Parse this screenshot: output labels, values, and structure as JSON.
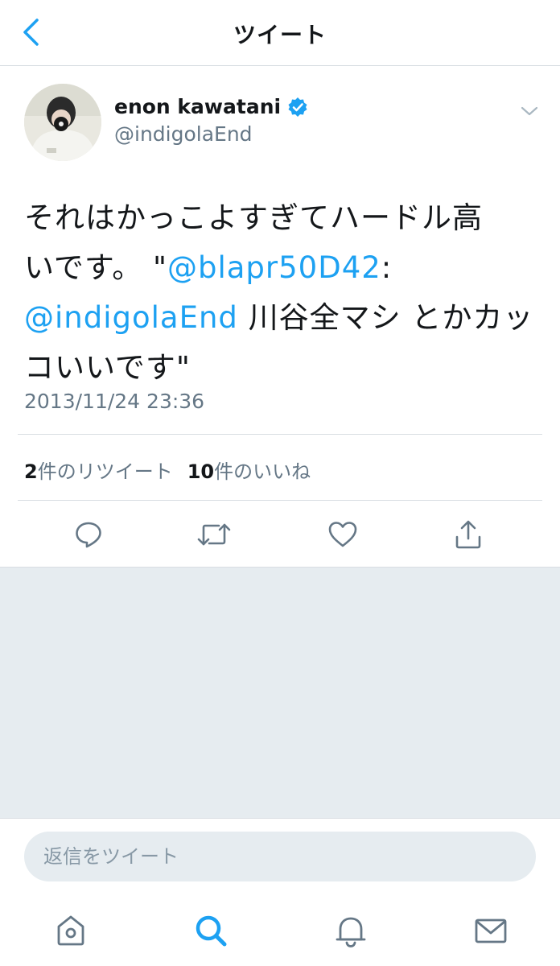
{
  "header": {
    "title": "ツイート"
  },
  "tweet": {
    "user": {
      "name": "enon kawatani",
      "handle": "@indigolaEnd"
    },
    "text": {
      "line1": "それはかっこよすぎてハードル高",
      "line2_prefix": "いです。 \"",
      "mention1": "@blapr50D42",
      "line2_suffix": ":",
      "mention2": "@indigolaEnd",
      "line3_suffix": " 川谷全マシ とかカッ",
      "line4": "コいいです\""
    },
    "timestamp": "2013/11/24 23:36",
    "stats": {
      "retweets_count": "2",
      "retweets_label": "件のリツイート",
      "likes_count": "10",
      "likes_label": "件のいいね"
    }
  },
  "reply": {
    "placeholder": "返信をツイート"
  },
  "icons": {
    "back": "chevron-left-icon",
    "verified": "verified-badge-icon",
    "caret": "chevron-down-icon",
    "reply": "reply-icon",
    "retweet": "retweet-icon",
    "like": "heart-icon",
    "share": "share-icon",
    "home": "home-icon",
    "search": "search-icon",
    "notifications": "bell-icon",
    "messages": "mail-icon"
  },
  "colors": {
    "accent": "#1da1f2",
    "secondary": "#657786",
    "background_gray": "#e6ecf0"
  }
}
